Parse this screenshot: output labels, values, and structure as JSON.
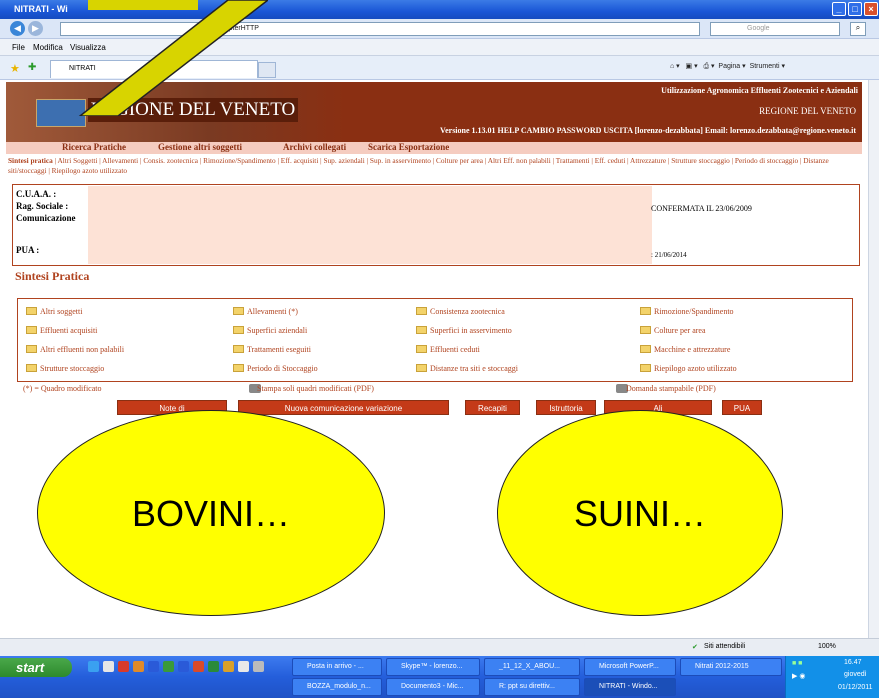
{
  "window": {
    "title": "NITRATI - Wi",
    "address_suffix": "rvlet/AdapterHTTP",
    "search_placeholder": "Google",
    "tab_title": "NITRATI"
  },
  "browser_menu": [
    "File",
    "Modifica",
    "Visualizza"
  ],
  "browser_tools": {
    "pagina": "Pagina",
    "strumenti": "Strumenti"
  },
  "banner": {
    "title": "REGIONE DEL VENETO",
    "top_right": "Utilizzazione Agronomica Effluenti Zootecnici e Aziendali",
    "region": "REGIONE DEL VENETO",
    "version_bar": "Versione 1.13.01   HELP   CAMBIO PASSWORD   USCITA   [lorenzo-dezabbata]   Email: lorenzo.dezabbata@regione.veneto.it"
  },
  "main_nav": [
    "Ricerca Pratiche",
    "Gestione altri soggetti",
    "Archivi collegati",
    "Scarica Esportazione"
  ],
  "sub_nav_active": "Sintesi pratica",
  "sub_nav_rest": " | Altri Soggetti | Allevamenti | Consis. zootecnica | Rimozione/Spandimento | Eff. acquisiti | Sup. aziendali | Sup. in asservimento | Colture per area | Altri Eff. non palabili | Trattamenti | Eff. ceduti | Attrezzature | Strutture stoccaggio | Periodo di stoccaggio | Distanze siti/stoccaggi | Riepilogo azoto utilizzato",
  "info": {
    "labels": [
      "C.U.A.A. :",
      "Rag. Sociale :",
      "Comunicazione",
      "",
      "PUA :"
    ],
    "status": "CONFERMATA IL 23/06/2009",
    "pua_date": ": 21/06/2014"
  },
  "section_title": "Sintesi Pratica",
  "grid_items": [
    [
      "Altri soggetti",
      "Allevamenti (*)",
      "Consistenza zootecnica",
      "Rimozione/Spandimento"
    ],
    [
      "Effluenti acquisiti",
      "Superfici aziendali",
      "Superfici in asservimento",
      "Colture per area"
    ],
    [
      "Altri effluenti non palabili",
      "Trattamenti eseguiti",
      "Effluenti ceduti",
      "Macchine e attrezzature"
    ],
    [
      "Strutture stoccaggio",
      "Periodo di Stoccaggio",
      "Distanze tra siti e stoccaggi",
      "Riepilogo azoto utilizzato"
    ]
  ],
  "footer_row": {
    "modified": "(*) = Quadro modificato",
    "print_modified": "Stampa soli quadri modificati (PDF)",
    "print_all": "Domanda stampabile (PDF)"
  },
  "action_buttons": [
    "Note di",
    "Nuova comunicazione variazione",
    "Recapiti",
    "Istruttoria",
    "Ali",
    "PUA"
  ],
  "overlays": {
    "left": "BOVINI…",
    "right": "SUINI…"
  },
  "status_bar": {
    "zone": "Siti attendibili",
    "zoom": "100%"
  },
  "taskbar": {
    "start": "start",
    "row1": [
      "Posta in arrivo - ...",
      "Skype™ - lorenzo...",
      "_11_12_X_ABOU...",
      "Microsoft PowerP...",
      "Nitrati 2012-2015"
    ],
    "row2": [
      "BOZZA_modulo_n...",
      "Documento3 - Mic...",
      "R: ppt su direttiv...",
      "NITRATI - Windo..."
    ],
    "time": "16.47",
    "day": "giovedì",
    "date": "01/12/2011"
  },
  "colors": {
    "accent": "#b0431f",
    "banner": "#8a2f12",
    "highlight": "#ffff00"
  }
}
